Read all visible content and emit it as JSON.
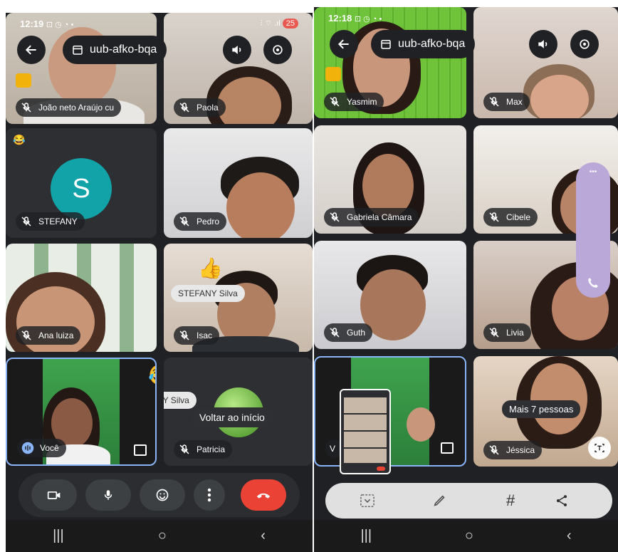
{
  "left": {
    "status_time": "12:19",
    "status_icons": "⊡ ◷ ◔ •",
    "status_right": "⫶ ⌔ .ıl",
    "battery": "25",
    "meeting_code": "uub-afko-bqa",
    "tiles": [
      {
        "name": "João neto Araújo cu"
      },
      {
        "name": "Paola"
      },
      {
        "name": "STEFANY",
        "avatar_letter": "S"
      },
      {
        "name": "Pedro"
      },
      {
        "name": "Ana luiza"
      },
      {
        "name": "Isac"
      },
      {
        "name": "Você"
      },
      {
        "name": "Patricia"
      }
    ],
    "reaction_label_1": "STEFANY Silva",
    "reaction_label_2": "STEFANY Silva",
    "reaction_emoji_1": "👍",
    "reaction_emoji_2": "😂",
    "reaction_emoji_3": "😂",
    "return_label": "Voltar ao início"
  },
  "right": {
    "status_time": "12:18",
    "status_icons": "⊡ ◷ ◔ •",
    "meeting_code": "uub-afko-bqa",
    "tiles": [
      {
        "name": "Yasmim"
      },
      {
        "name": "Max"
      },
      {
        "name": "Gabriela Câmara"
      },
      {
        "name": "Cibele"
      },
      {
        "name": "Guth"
      },
      {
        "name": "Livia"
      },
      {
        "name": "V"
      },
      {
        "name": "Jéssica"
      }
    ],
    "more_people": "Mais 7 pessoas",
    "more_dots": "•••",
    "toolbar_hash": "#"
  },
  "colors": {
    "end_call": "#ea4335",
    "avatar": "#12a3a8",
    "selected_border": "#8ab4f8",
    "side_panel": "#b9a8d8"
  }
}
